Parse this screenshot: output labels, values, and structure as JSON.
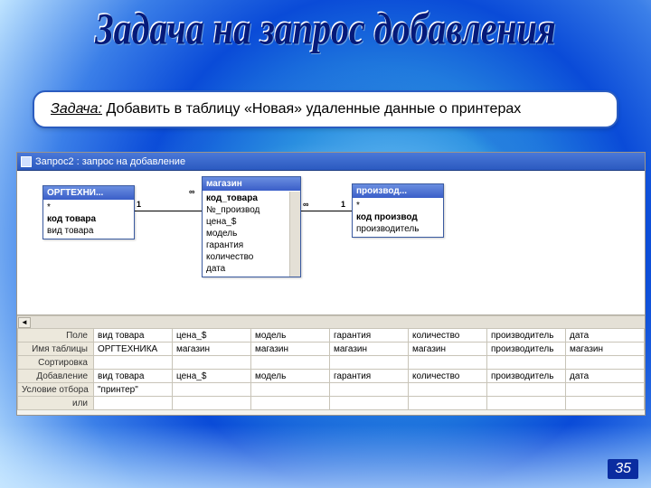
{
  "slide": {
    "title": "Задача на запрос добавления",
    "task_label": "Задача:",
    "task_text": " Добавить в таблицу «Новая» удаленные данные о принтерах",
    "page_number": "35"
  },
  "window": {
    "title": "Запрос2 : запрос на добавление"
  },
  "tables": {
    "t1": {
      "name": "ОРГТЕХНИ...",
      "fields": [
        "*",
        "код товара",
        "вид товара"
      ]
    },
    "t2": {
      "name": "магазин",
      "fields": [
        "код_товара",
        "№_производ",
        "цена_$",
        "модель",
        "гарантия",
        "количество",
        "дата"
      ]
    },
    "t3": {
      "name": "производ...",
      "fields": [
        "*",
        "код производ",
        "производитель"
      ]
    }
  },
  "relations": {
    "left_one": "1",
    "left_inf": "∞",
    "right_inf": "∞",
    "right_one": "1"
  },
  "gridRows": {
    "r1": "Поле",
    "r2": "Имя таблицы",
    "r3": "Сортировка",
    "r4": "Добавление",
    "r5": "Условие отбора",
    "r6": "или"
  },
  "cols": [
    {
      "field": "вид товара",
      "table": "ОРГТЕХНИКА",
      "append": "вид товара",
      "crit": "\"принтер\""
    },
    {
      "field": "цена_$",
      "table": "магазин",
      "append": "цена_$",
      "crit": ""
    },
    {
      "field": "модель",
      "table": "магазин",
      "append": "модель",
      "crit": ""
    },
    {
      "field": "гарантия",
      "table": "магазин",
      "append": "гарантия",
      "crit": ""
    },
    {
      "field": "количество",
      "table": "магазин",
      "append": "количество",
      "crit": ""
    },
    {
      "field": "производитель",
      "table": "производитель",
      "append": "производитель",
      "crit": ""
    },
    {
      "field": "дата",
      "table": "магазин",
      "append": "дата",
      "crit": ""
    }
  ]
}
